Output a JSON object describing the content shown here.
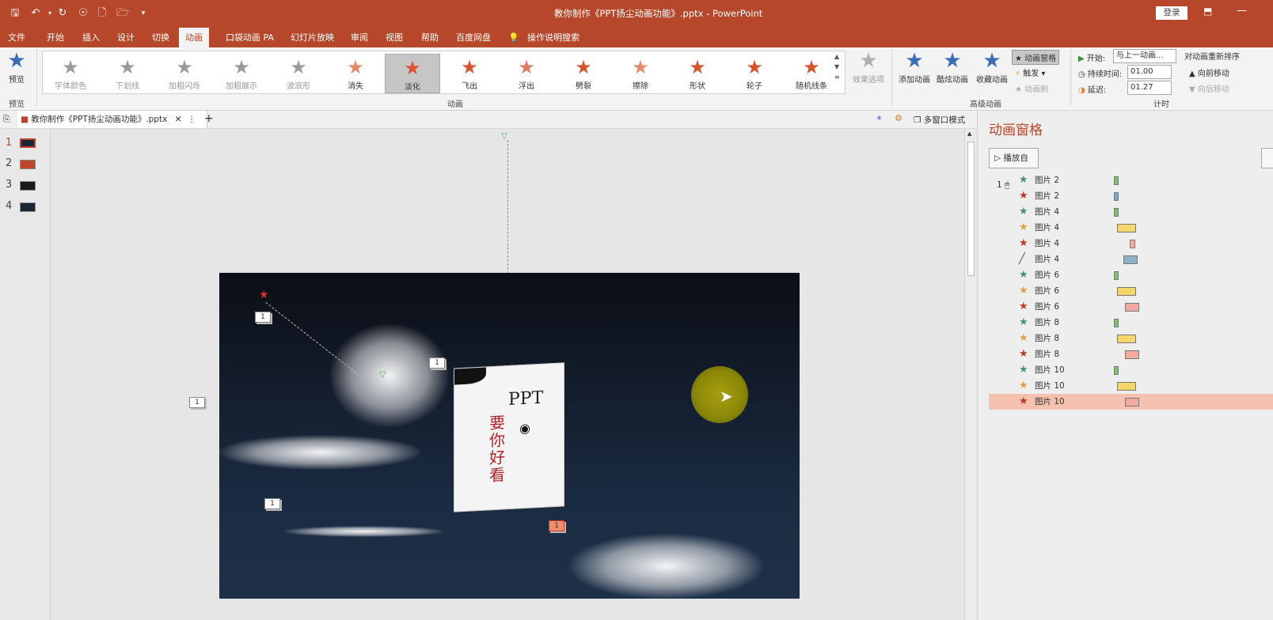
{
  "title": {
    "document": "教你制作《PPT扬尘动画功能》.pptx - PowerPoint",
    "login": "登录"
  },
  "tabs": [
    "文件",
    "开始",
    "插入",
    "设计",
    "切换",
    "动画",
    "口袋动画 PA",
    "幻灯片放映",
    "审阅",
    "视图",
    "帮助",
    "百度网盘"
  ],
  "search_label": "操作说明搜索",
  "ribbon": {
    "preview_label": "预览",
    "preview_group": "预览",
    "gallery": [
      {
        "label": "字体颜色",
        "color": "#9a9a9a"
      },
      {
        "label": "下划线",
        "color": "#9a9a9a"
      },
      {
        "label": "加粗闪烁",
        "color": "#9a9a9a"
      },
      {
        "label": "加粗展示",
        "color": "#9a9a9a"
      },
      {
        "label": "波浪形",
        "color": "#9a9a9a"
      },
      {
        "label": "消失",
        "color": "#e8886a"
      },
      {
        "label": "淡化",
        "color": "#d9532f"
      },
      {
        "label": "飞出",
        "color": "#d9532f"
      },
      {
        "label": "浮出",
        "color": "#e07a5f"
      },
      {
        "label": "劈裂",
        "color": "#d9532f"
      },
      {
        "label": "擦除",
        "color": "#e8886a"
      },
      {
        "label": "形状",
        "color": "#d9532f"
      },
      {
        "label": "轮子",
        "color": "#d9532f"
      },
      {
        "label": "随机线条",
        "color": "#d9532f"
      }
    ],
    "effect_options": "效果选项",
    "animation_group": "动画",
    "add_animation": "添加动画",
    "cool_animation": "酷炫动画",
    "fav_animation": "收藏动画",
    "animation_pane": "动画窗格",
    "trigger": "触发",
    "painter": "动画刷",
    "advanced_group": "高级动画",
    "start_label": "开始:",
    "start_value": "与上一动画...",
    "duration_label": "持续时间:",
    "duration_value": "01.00",
    "delay_label": "延迟:",
    "delay_value": "01.27",
    "timing_group": "计时",
    "reorder": "对动画重新排序",
    "move_earlier": "向前移动",
    "move_later": "向后移动"
  },
  "doc_tab": "教你制作《PPT扬尘动画功能》.pptx",
  "multi_window": "多窗口模式",
  "slides": [
    {
      "num": "1",
      "color": "#1c2536"
    },
    {
      "num": "2",
      "color": "#c0442b"
    },
    {
      "num": "3",
      "color": "#1a1a1a"
    },
    {
      "num": "4",
      "color": "#1c2536"
    }
  ],
  "slide_tags": [
    "1",
    "1",
    "1",
    "1",
    "1"
  ],
  "book": {
    "title": "PPT",
    "subtitle": "要你好看"
  },
  "pane": {
    "title": "动画窗格",
    "play_from": "播放自",
    "row_first_num": "1",
    "rows": [
      {
        "label": "图片 2",
        "star": "#4a8f6e",
        "bar": "green",
        "start": 0,
        "len": 1
      },
      {
        "label": "图片 2",
        "star": "#c0392b",
        "bar": "blue",
        "start": 0,
        "len": 1
      },
      {
        "label": "图片 4",
        "star": "#4a8f6e",
        "bar": "green",
        "start": 0,
        "len": 1
      },
      {
        "label": "图片 4",
        "star": "#e0a040",
        "bar": "yellow",
        "start": 1,
        "len": 4
      },
      {
        "label": "图片 4",
        "star": "#c0392b",
        "bar": "pink",
        "start": 5,
        "len": 1.2
      },
      {
        "label": "图片 4",
        "star": "#555555",
        "bar": "steel",
        "start": 3,
        "len": 3
      },
      {
        "label": "图片 6",
        "star": "#4a8f6e",
        "bar": "green",
        "start": 0,
        "len": 1
      },
      {
        "label": "图片 6",
        "star": "#e0a040",
        "bar": "yellow",
        "start": 1,
        "len": 4
      },
      {
        "label": "图片 6",
        "star": "#c0392b",
        "bar": "pink",
        "start": 3.5,
        "len": 3
      },
      {
        "label": "图片 8",
        "star": "#4a8f6e",
        "bar": "green",
        "start": 0,
        "len": 1
      },
      {
        "label": "图片 8",
        "star": "#e0a040",
        "bar": "yellow",
        "start": 1,
        "len": 4
      },
      {
        "label": "图片 8",
        "star": "#c0392b",
        "bar": "pink",
        "start": 3.5,
        "len": 3
      },
      {
        "label": "图片 10",
        "star": "#4a8f6e",
        "bar": "green",
        "start": 0,
        "len": 1
      },
      {
        "label": "图片 10",
        "star": "#e0a040",
        "bar": "yellow",
        "start": 1,
        "len": 4
      },
      {
        "label": "图片 10",
        "star": "#c0392b",
        "bar": "pink",
        "start": 3.5,
        "len": 3,
        "selected": true
      }
    ]
  },
  "colors": {
    "accent": "#b7472a",
    "selected_row": "#f4c2ae"
  }
}
